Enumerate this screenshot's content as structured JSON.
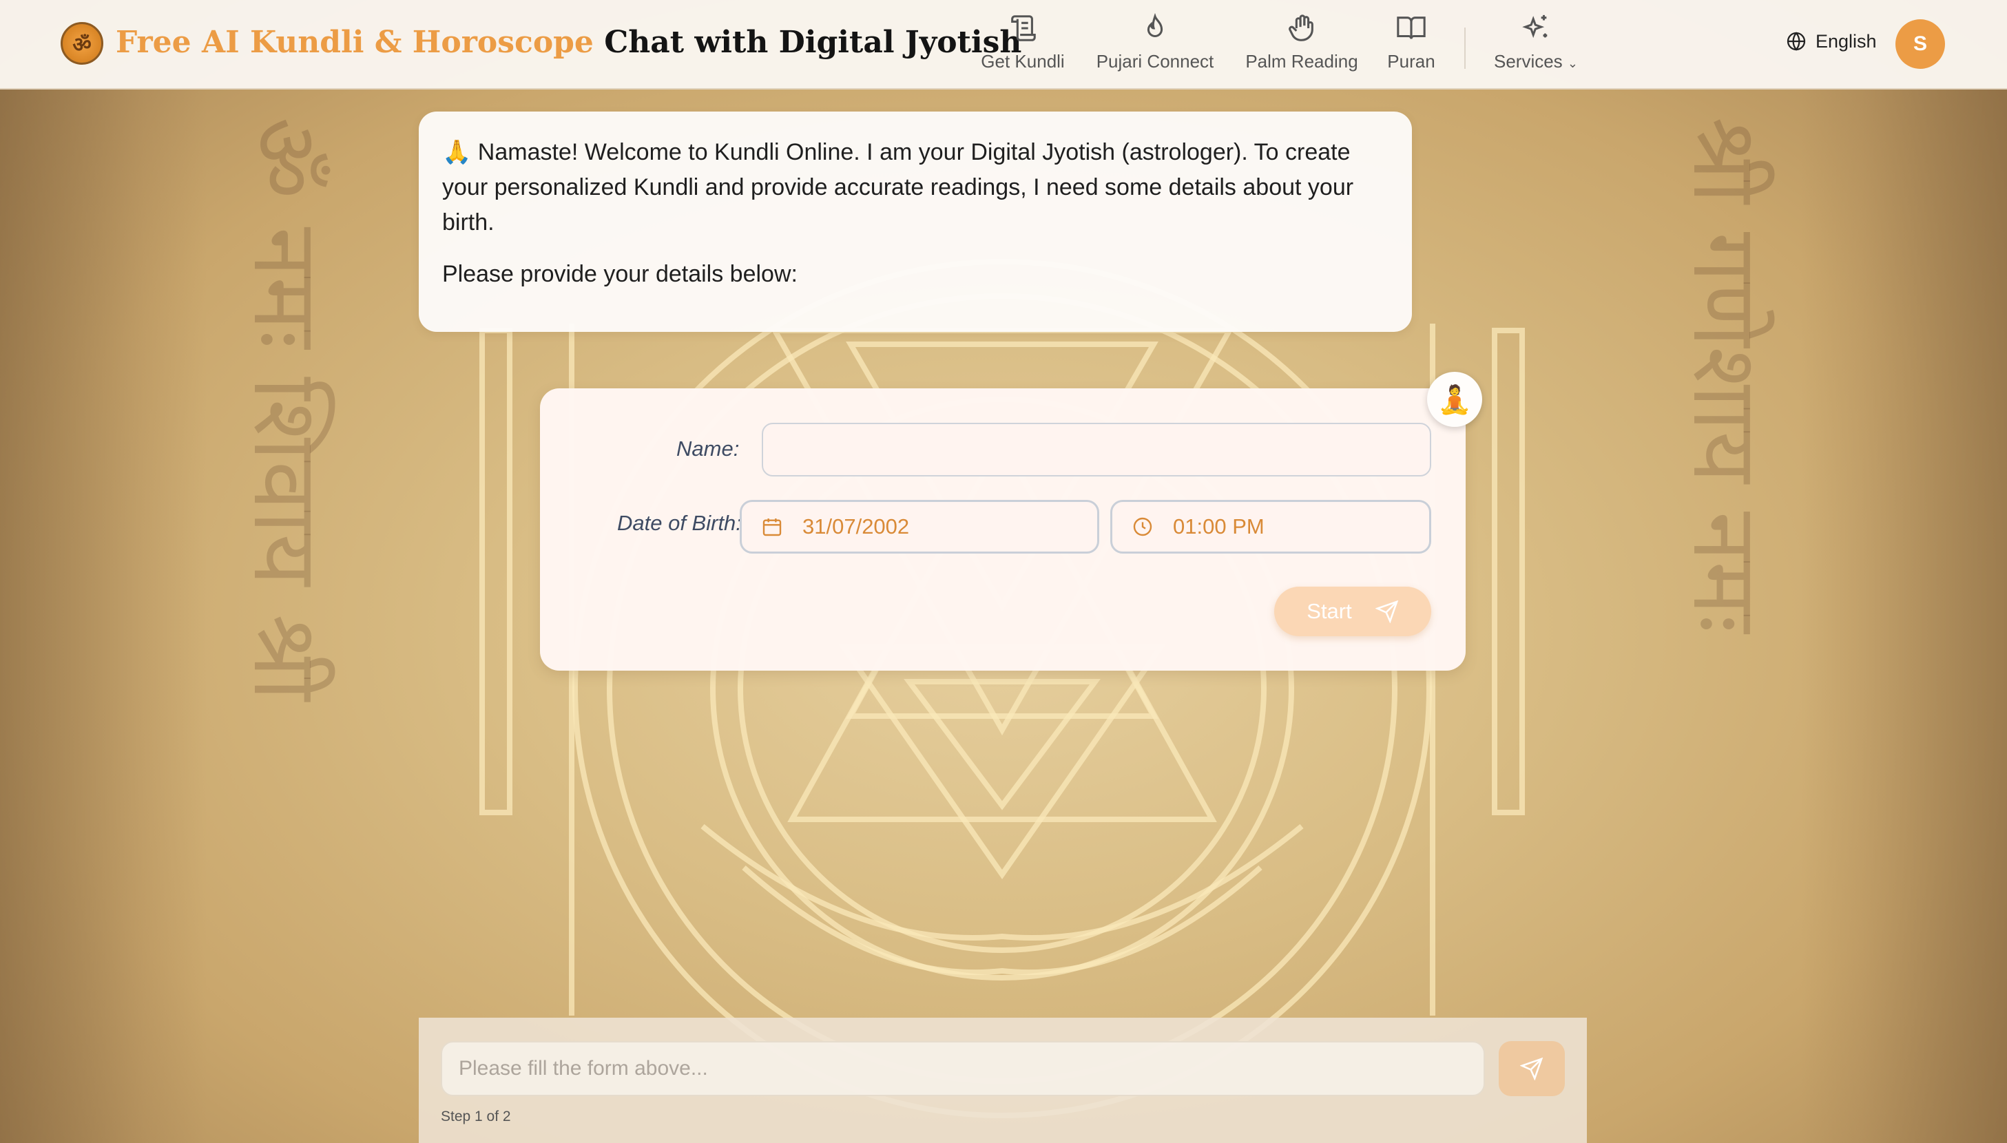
{
  "header": {
    "brand_accent": "Free AI Kundli & Horoscope",
    "brand_main": "Chat with Digital Jyotish",
    "logo_glyph": "ॐ",
    "nav": [
      {
        "label": "Get Kundli",
        "icon": "scroll-icon"
      },
      {
        "label": "Pujari Connect",
        "icon": "flame-icon"
      },
      {
        "label": "Palm Reading",
        "icon": "hand-icon"
      },
      {
        "label": "Puran",
        "icon": "book-open-icon"
      },
      {
        "label": "Services",
        "icon": "sparkles-icon"
      }
    ],
    "language": "English",
    "avatar_initial": "S"
  },
  "chat": {
    "welcome_text": "🙏 Namaste! Welcome to Kundli Online. I am your Digital Jyotish (astrologer). To create your personalized Kundli and provide accurate readings, I need some details about your birth.",
    "prompt_text": "Please provide your details below:"
  },
  "form": {
    "name_label": "Name:",
    "name_value": "",
    "dob_label": "Date of Birth:",
    "date_value": "31/07/2002",
    "time_value": "01:00 PM",
    "start_label": "Start",
    "badge_emoji": "🧘"
  },
  "composer": {
    "placeholder": "Please fill the form above...",
    "step_text": "Step 1 of 2"
  },
  "colors": {
    "accent": "#ec9c45",
    "start_button": "#fbd7b5",
    "input_text": "#d98a37"
  }
}
